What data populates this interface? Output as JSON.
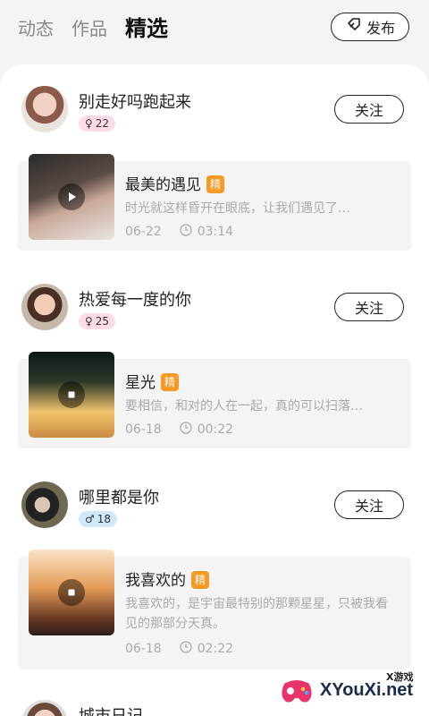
{
  "header": {
    "tabs": [
      {
        "label": "动态"
      },
      {
        "label": "作品"
      },
      {
        "label": "精选",
        "active": true
      }
    ],
    "publish_label": "发布",
    "publish_icon": "edit-tag-icon"
  },
  "posts": [
    {
      "user": "别走好吗跑起来",
      "gender": "female",
      "gender_symbol": "♀",
      "badge_count": "22",
      "follow_label": "关注",
      "title": "最美的遇见",
      "tag": "精",
      "desc": "时光就这样昏开在眼底，让我们遇见了…",
      "date": "06-22",
      "duration": "03:14",
      "media_state": "play"
    },
    {
      "user": "热爱每一度的你",
      "gender": "female",
      "gender_symbol": "♀",
      "badge_count": "25",
      "follow_label": "关注",
      "title": "星光",
      "tag": "精",
      "desc": "要相信，和对的人在一起，真的可以扫落…",
      "date": "06-18",
      "duration": "00:22",
      "media_state": "stop"
    },
    {
      "user": "哪里都是你",
      "gender": "male",
      "gender_symbol": "♂",
      "badge_count": "18",
      "follow_label": "关注",
      "title": "我喜欢的",
      "tag": "精",
      "desc": "我喜欢的，是宇宙最特别的那颗星星，只被我看见的那部分天真。",
      "date": "06-18",
      "duration": "02:22",
      "media_state": "stop"
    },
    {
      "user": "城市日记"
    }
  ],
  "watermark": {
    "small": "X游戏",
    "big": "XYouXi.net"
  },
  "colors": {
    "accent_tag": "#f59a24",
    "female_badge": "#ffdbe6",
    "male_badge": "#cfe9fb"
  }
}
